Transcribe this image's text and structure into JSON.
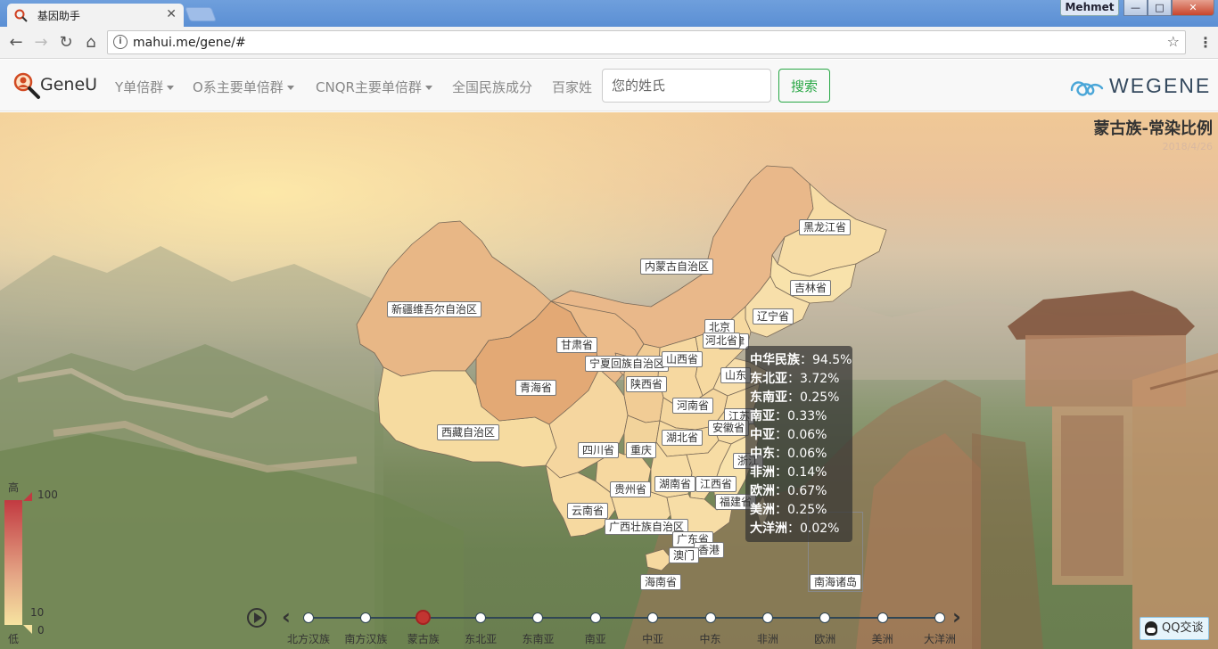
{
  "browser": {
    "tab_title": "基因助手",
    "url": "mahui.me/gene/#",
    "user": "Mehmet",
    "window_controls": {
      "minimize": "—",
      "maximize": "□",
      "close": "✕"
    }
  },
  "navbar": {
    "brand": "GeneU",
    "items": [
      {
        "label": "Y单倍群",
        "dropdown": true
      },
      {
        "label": "O系主要单倍群",
        "dropdown": true
      },
      {
        "label": "CNQR主要单倍群",
        "dropdown": true
      },
      {
        "label": "全国民族成分",
        "dropdown": false
      },
      {
        "label": "百家姓",
        "dropdown": false
      }
    ],
    "search_placeholder": "您的姓氏",
    "search_button": "搜索",
    "partner_logo": "WEGENE"
  },
  "chart": {
    "title": "蒙古族-常染比例",
    "date": "2018/4/26"
  },
  "chart_data": {
    "type": "map",
    "region": "China",
    "selected_province": "北京",
    "provinces": [
      "黑龙江省",
      "吉林省",
      "辽宁省",
      "内蒙古自治区",
      "新疆维吾尔自治区",
      "甘肃省",
      "宁夏回族自治区",
      "北京",
      "天津",
      "河北省",
      "山西省",
      "山东",
      "青海省",
      "陕西省",
      "河南省",
      "江苏",
      "安徽省",
      "西藏自治区",
      "四川省",
      "重庆",
      "湖北省",
      "浙江",
      "贵州省",
      "湖南省",
      "江西省",
      "福建省",
      "云南省",
      "广西壮族自治区",
      "广东省",
      "香港",
      "澳门",
      "海南省",
      "南海诸岛"
    ],
    "tooltip": [
      {
        "label": "中华民族",
        "value": "94.5%"
      },
      {
        "label": "东北亚",
        "value": "3.72%"
      },
      {
        "label": "东南亚",
        "value": "0.25%"
      },
      {
        "label": "南亚",
        "value": "0.33%"
      },
      {
        "label": "中亚",
        "value": "0.06%"
      },
      {
        "label": "中东",
        "value": "0.06%"
      },
      {
        "label": "非洲",
        "value": "0.14%"
      },
      {
        "label": "欧洲",
        "value": "0.67%"
      },
      {
        "label": "美洲",
        "value": "0.25%"
      },
      {
        "label": "大洋洲",
        "value": "0.02%"
      }
    ],
    "visual_map": {
      "high_label": "高",
      "low_label": "低",
      "max": 100,
      "mid": 10,
      "min": 0,
      "color_high": "#c23a41",
      "color_low": "#f6e3a0"
    },
    "timeline": {
      "items": [
        "北方汉族",
        "南方汉族",
        "蒙古族",
        "东北亚",
        "东南亚",
        "南亚",
        "中亚",
        "中东",
        "非洲",
        "欧洲",
        "美洲",
        "大洋洲"
      ],
      "active_index": 2
    }
  },
  "widgets": {
    "qq_button": "QQ交谈"
  }
}
